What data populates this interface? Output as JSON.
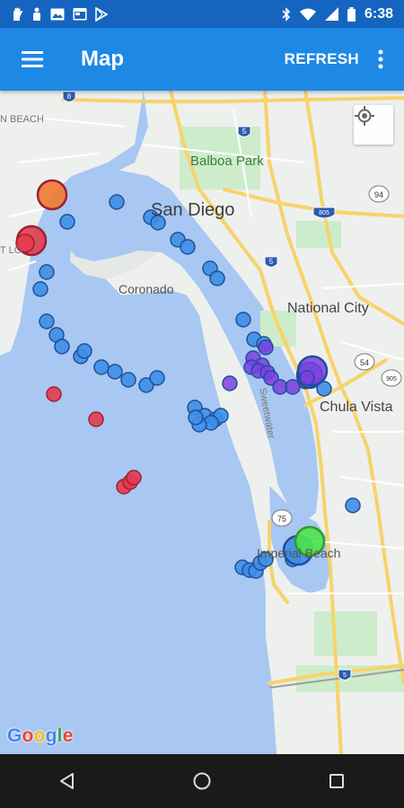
{
  "status_bar": {
    "time": "6:38",
    "left_icons": [
      "hand-icon",
      "person-icon",
      "image-icon",
      "calendar-icon",
      "play-store-icon"
    ],
    "right_icons": [
      "bluetooth-icon",
      "wifi-icon",
      "cellular-icon",
      "battery-icon"
    ]
  },
  "app_bar": {
    "menu_icon": "hamburger-menu-icon",
    "title": "Map",
    "refresh_label": "REFRESH",
    "overflow_icon": "more-vert-icon"
  },
  "map": {
    "labels": {
      "san_diego": "San Diego",
      "balboa_park": "Balboa Park",
      "coronado": "Coronado",
      "national_city": "National City",
      "chula_vista": "Chula Vista",
      "imperial_beach": "Imperial Beach",
      "ocean_beach": "N BEACH",
      "point_loma": "T LO",
      "bay_label": "Sweetwater"
    },
    "shields": {
      "i8": "8",
      "i5a": "5",
      "i5b": "5",
      "i805": "805",
      "r94": "94",
      "r54": "54",
      "r75": "75",
      "r905": "905",
      "i5c": "5"
    },
    "locate_icon": "my-location-icon",
    "attribution": "Google",
    "marker_colors": {
      "blue": "#3d8ee6",
      "red": "#e23b4e",
      "orange": "#f07a30",
      "purple": "#7a3fe0",
      "green": "#4fe34a",
      "stroke": "#1e4f9c"
    }
  },
  "nav_bar": {
    "back_icon": "back-triangle-icon",
    "home_icon": "home-circle-icon",
    "recents_icon": "recents-square-icon"
  }
}
